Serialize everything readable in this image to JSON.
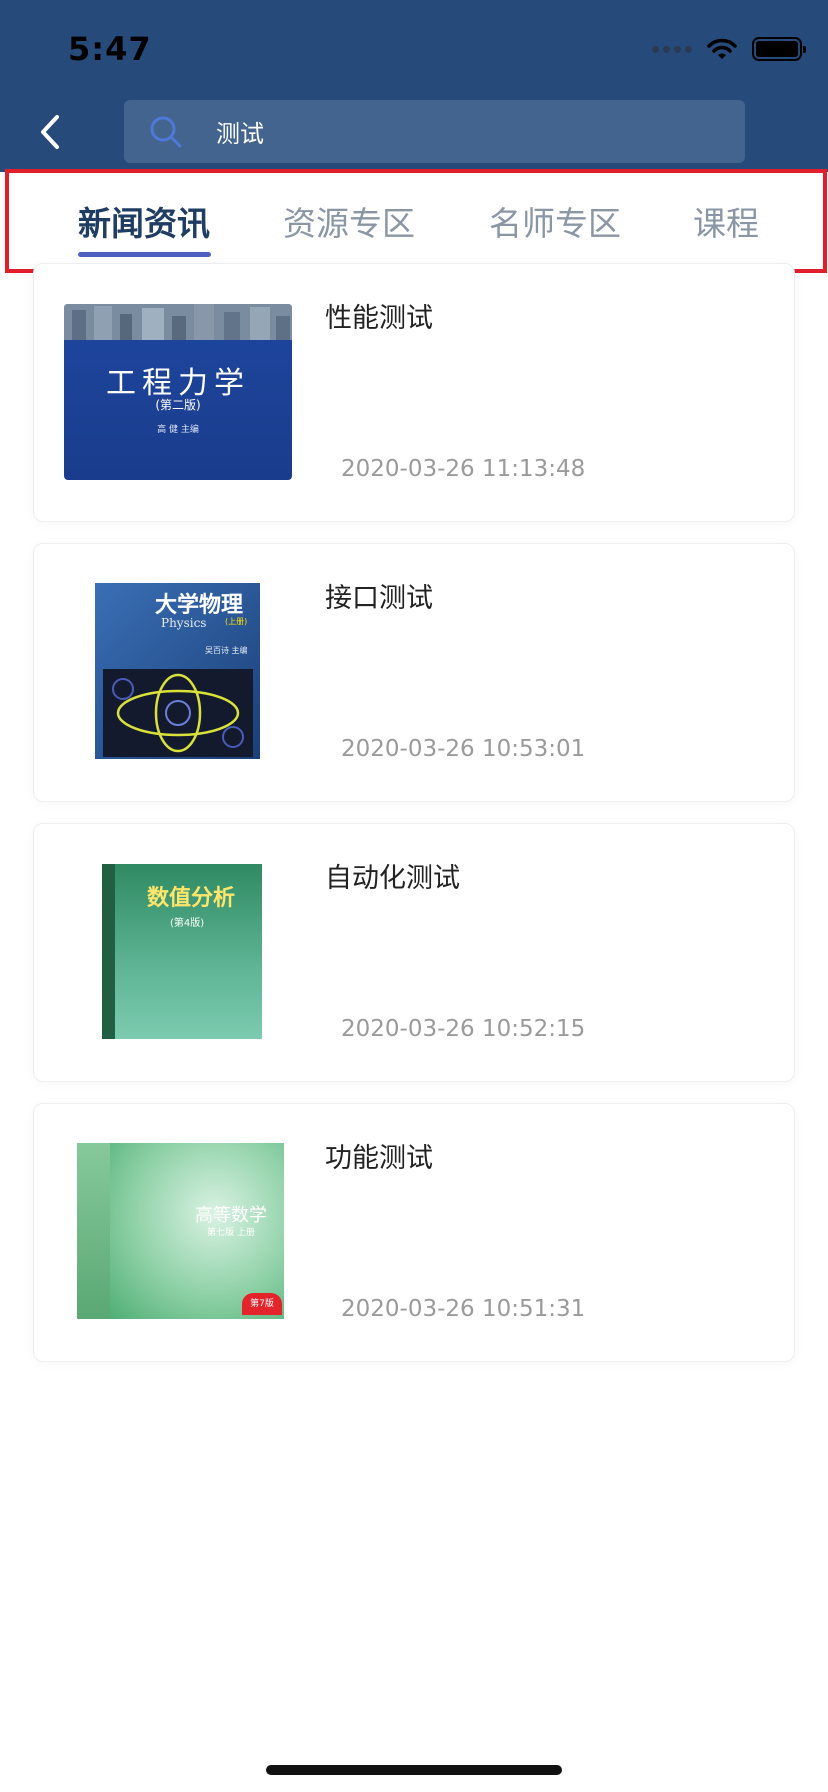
{
  "status_bar": {
    "time": "5:47"
  },
  "search": {
    "query": "测试"
  },
  "tabs": [
    {
      "label": "新闻资讯",
      "active": true
    },
    {
      "label": "资源专区",
      "active": false
    },
    {
      "label": "名师专区",
      "active": false
    },
    {
      "label": "课程",
      "active": false
    }
  ],
  "articles": [
    {
      "title": "性能测试",
      "timestamp": "2020-03-26 11:13:48",
      "cover": {
        "title": "工程力学",
        "edition": "(第二版)",
        "author": "高 健 主编"
      }
    },
    {
      "title": "接口测试",
      "timestamp": "2020-03-26 10:53:01",
      "cover": {
        "title": "大学物理",
        "subtitle": "Physics",
        "edition": "(上册)",
        "author": "吴百诗 主编"
      }
    },
    {
      "title": "自动化测试",
      "timestamp": "2020-03-26 10:52:15",
      "cover": {
        "title": "数值分析",
        "edition": "(第4版)"
      }
    },
    {
      "title": "功能测试",
      "timestamp": "2020-03-26 10:51:31",
      "cover": {
        "title": "高等数学",
        "edition": "第七版 上册",
        "badge": "第7版"
      }
    }
  ],
  "colors": {
    "header": "#264a7a",
    "search_bg": "#42648e",
    "tab_active": "#1f3d63",
    "tab_inactive": "#8a96a6",
    "tab_underline": "#4e61c2",
    "highlight_border": "#e01f2a"
  }
}
